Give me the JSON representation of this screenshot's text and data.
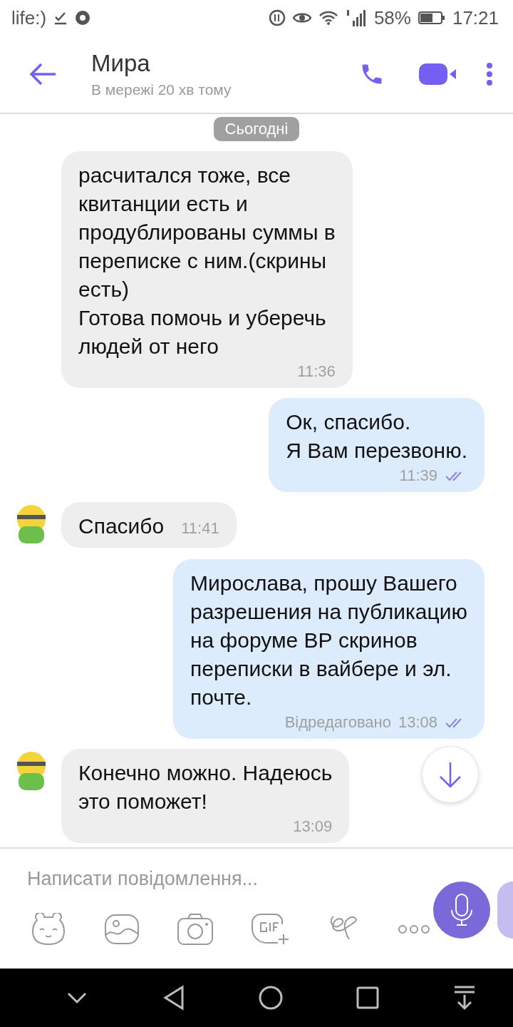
{
  "status_bar": {
    "carrier": "life:)",
    "battery": "58%",
    "time": "17:21"
  },
  "header": {
    "title": "Мира",
    "subtitle": "В мережі 20 хв тому"
  },
  "date_pill": "Сьогодні",
  "messages": [
    {
      "kind": "incoming",
      "avatar": false,
      "text": "расчитался тоже, все\nквитанции есть и\nпродублированы суммы в\nпереписке с ним.(скрины\nесть)\nГотова помочь и уберечь\nлюдей от него",
      "time": "11:36",
      "read": false
    },
    {
      "kind": "outgoing",
      "text": "Ок, спасибо.\nЯ Вам перезвоню.",
      "time": "11:39",
      "read": true
    },
    {
      "kind": "incoming",
      "avatar": true,
      "text": "Спасибо",
      "time": "11:41",
      "read": false
    },
    {
      "kind": "outgoing",
      "text": "Мирослава, прошу Вашего\nразрешения на публикацию\nна форуме ВР  скринов\nпереписки в вайбере и эл.\nпочте.",
      "edited": "Відредаговано",
      "time": "13:08",
      "read": true
    },
    {
      "kind": "incoming",
      "avatar": true,
      "text": "Конечно можно. Надеюсь\nэто поможет!",
      "time": "13:09",
      "read": false
    }
  ],
  "composer": {
    "placeholder": "Написати повідомлення..."
  }
}
